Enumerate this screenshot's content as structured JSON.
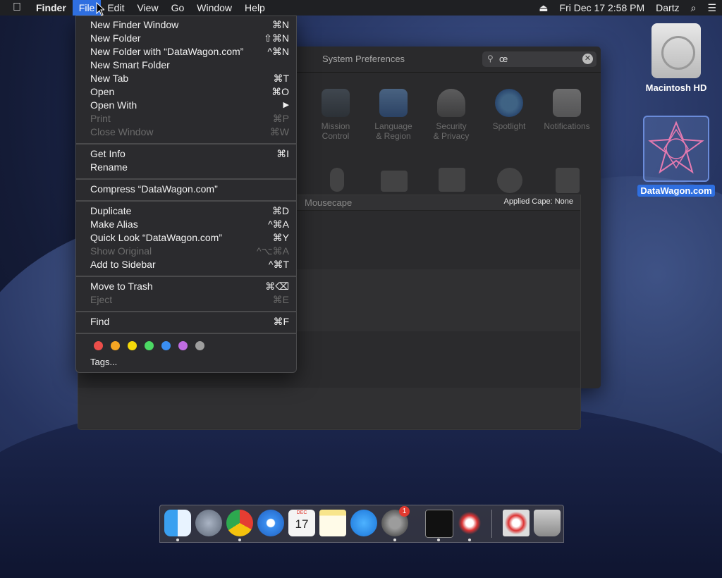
{
  "menubar": {
    "apple": "",
    "app": "Finder",
    "menus": [
      "File",
      "Edit",
      "View",
      "Go",
      "Window",
      "Help"
    ],
    "right": {
      "eject": "⏏",
      "datetime": "Fri Dec 17  2:58 PM",
      "user": "Dartz",
      "search": "⌕",
      "list": "☰"
    }
  },
  "sysprefs": {
    "title": "System Preferences",
    "search_value": "œ",
    "prefs": [
      {
        "label": "Mission\nControl"
      },
      {
        "label": "Language\n& Region"
      },
      {
        "label": "Security\n& Privacy"
      },
      {
        "label": "Spotlight"
      },
      {
        "label": "Notifications"
      }
    ]
  },
  "mousecape": {
    "title": "Mousecape",
    "applied": "Applied Cape: None"
  },
  "file_menu": {
    "items": [
      {
        "label": "New Finder Window",
        "shortcut": "⌘N",
        "disabled": false
      },
      {
        "label": "New Folder",
        "shortcut": "⇧⌘N",
        "disabled": false
      },
      {
        "label": "New Folder with “DataWagon.com”",
        "shortcut": "^⌘N",
        "disabled": false
      },
      {
        "label": "New Smart Folder",
        "shortcut": "",
        "disabled": false
      },
      {
        "label": "New Tab",
        "shortcut": "⌘T",
        "disabled": false
      },
      {
        "label": "Open",
        "shortcut": "⌘O",
        "disabled": false
      },
      {
        "label": "Open With",
        "shortcut": "▶",
        "disabled": false
      },
      {
        "label": "Print",
        "shortcut": "⌘P",
        "disabled": true
      },
      {
        "label": "Close Window",
        "shortcut": "⌘W",
        "disabled": true
      },
      {
        "label": "Get Info",
        "shortcut": "⌘I",
        "disabled": false
      },
      {
        "label": "Rename",
        "shortcut": "",
        "disabled": false
      },
      {
        "label": "Compress “DataWagon.com”",
        "shortcut": "",
        "disabled": false
      },
      {
        "label": "Duplicate",
        "shortcut": "⌘D",
        "disabled": false
      },
      {
        "label": "Make Alias",
        "shortcut": "^⌘A",
        "disabled": false
      },
      {
        "label": "Quick Look “DataWagon.com”",
        "shortcut": "⌘Y",
        "disabled": false
      },
      {
        "label": "Show Original",
        "shortcut": "^⌥⌘A",
        "disabled": true
      },
      {
        "label": "Add to Sidebar",
        "shortcut": "^⌘T",
        "disabled": false
      },
      {
        "label": "Move to Trash",
        "shortcut": "⌘⌫",
        "disabled": false
      },
      {
        "label": "Eject",
        "shortcut": "⌘E",
        "disabled": true
      },
      {
        "label": "Find",
        "shortcut": "⌘F",
        "disabled": false
      }
    ],
    "tag_colors": [
      "#ec4e4a",
      "#f5a623",
      "#f5d90a",
      "#4cd964",
      "#3a8ff3",
      "#c06de2",
      "#9e9e9e"
    ],
    "tags_label": "Tags..."
  },
  "desktop": {
    "icons": [
      {
        "label": "Macintosh HD"
      },
      {
        "label": "DataWagon.com"
      }
    ]
  },
  "dock": {
    "apps": [
      "finder-icon",
      "launchpad-icon",
      "chrome-icon",
      "safari-icon",
      "calendar-icon",
      "notes-icon",
      "app-store-icon",
      "system-preferences-icon",
      "terminal-icon",
      "mousecape-icon",
      "mousecape-doc-icon",
      "trash-icon"
    ],
    "calendar": {
      "month": "DEC",
      "day": "17"
    },
    "badge": "1"
  }
}
